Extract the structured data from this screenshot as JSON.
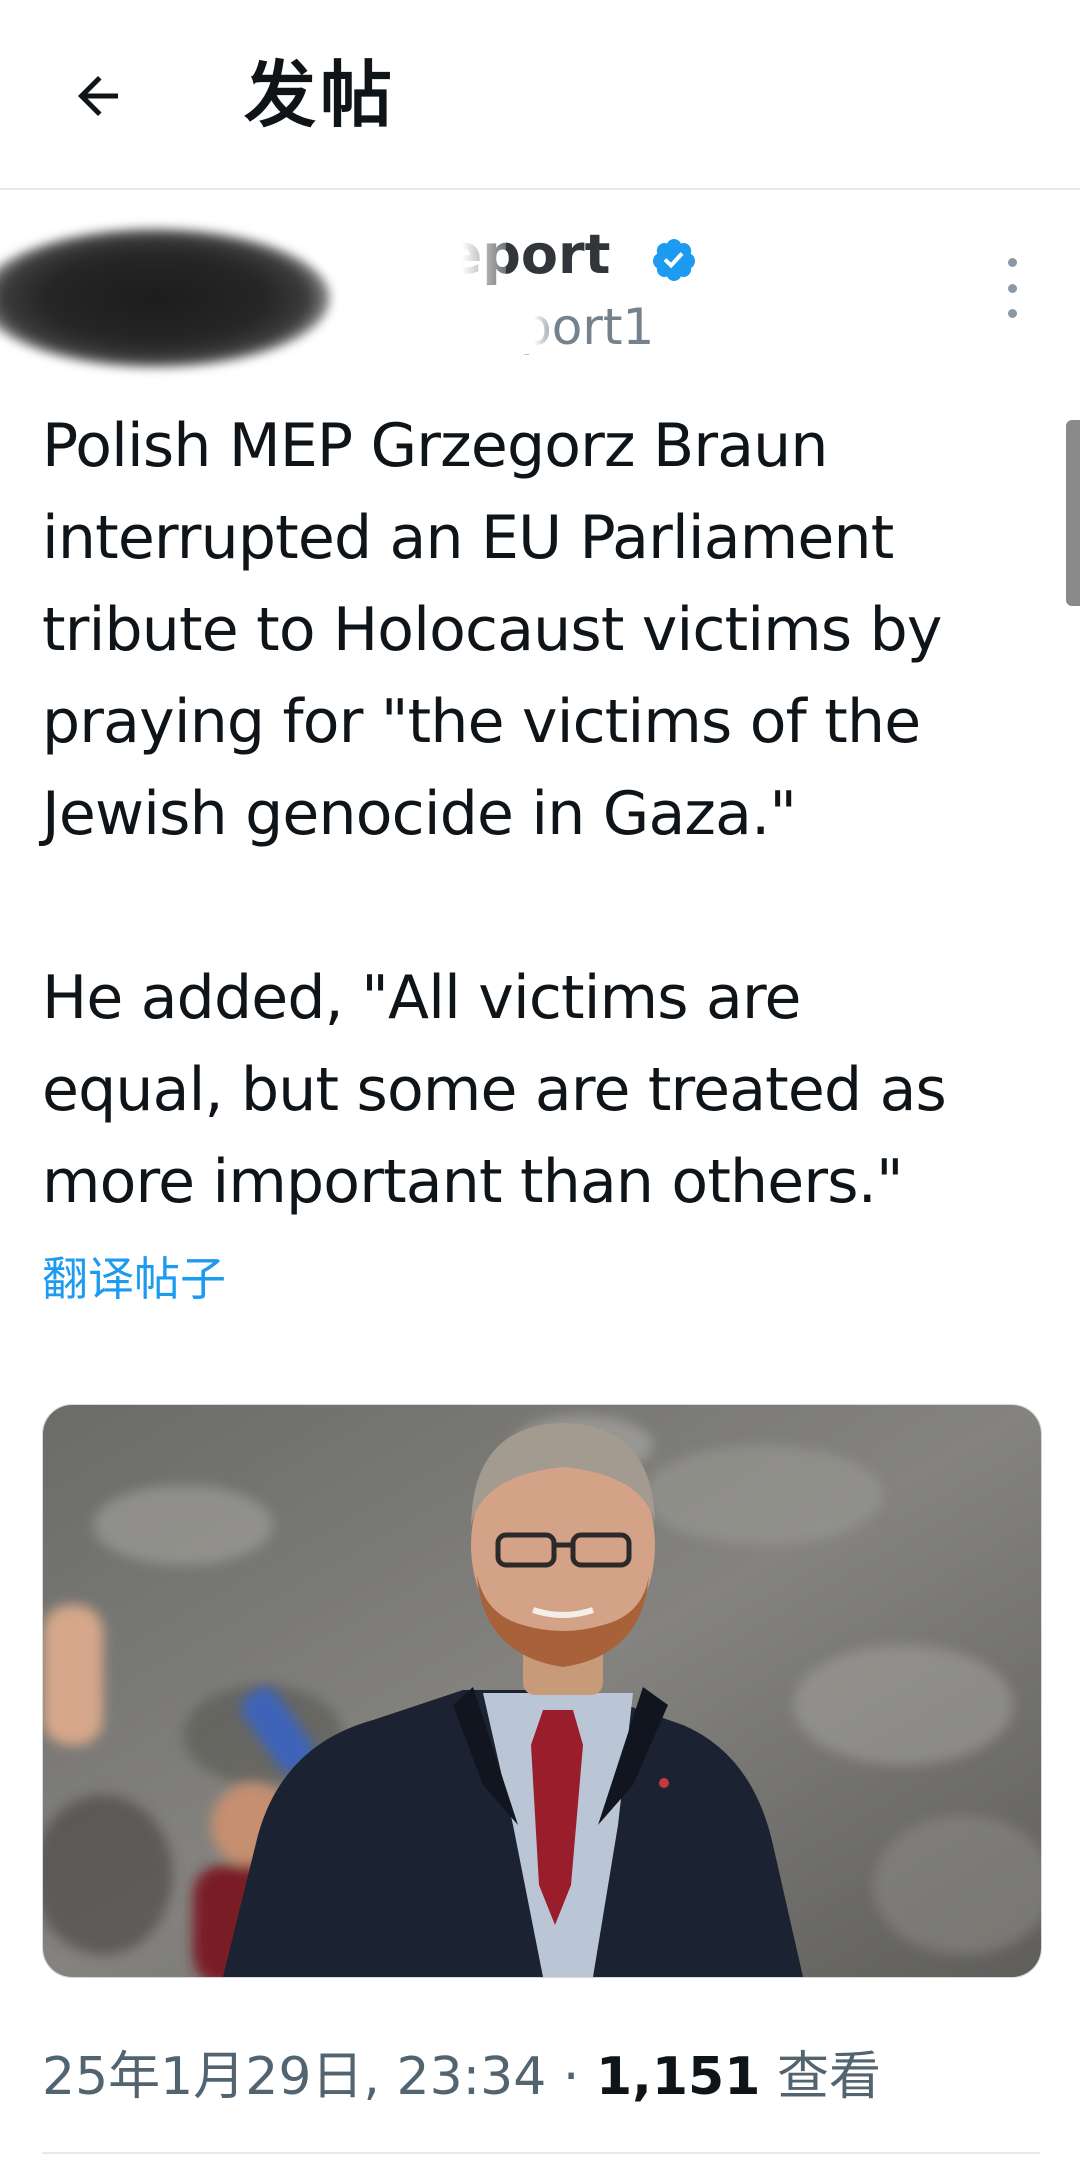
{
  "header": {
    "back_icon": "arrow-left-icon",
    "title": "发帖"
  },
  "author": {
    "display_name": "Report",
    "handle": "port1",
    "verified_icon": "verified-badge-icon",
    "verified_color": "#1d9bf0",
    "more_icon": "more-vertical-icon"
  },
  "post": {
    "text": "Polish MEP Grzegorz Braun\ninterrupted an EU Parliament\ntribute to Holocaust victims by\npraying for \"the victims of the\nJewish genocide in Gaza.\"\n\nHe added, \"All victims are\nequal, but some are treated as\nmore important than others.\"",
    "translate_label": "翻译帖子"
  },
  "meta": {
    "timestamp": "25年1月29日, 23:34",
    "separator": " · ",
    "views_count": "1,151",
    "views_label": " 查看"
  },
  "colors": {
    "link": "#1d9bf0",
    "text": "#0f1419",
    "muted": "#536471"
  }
}
